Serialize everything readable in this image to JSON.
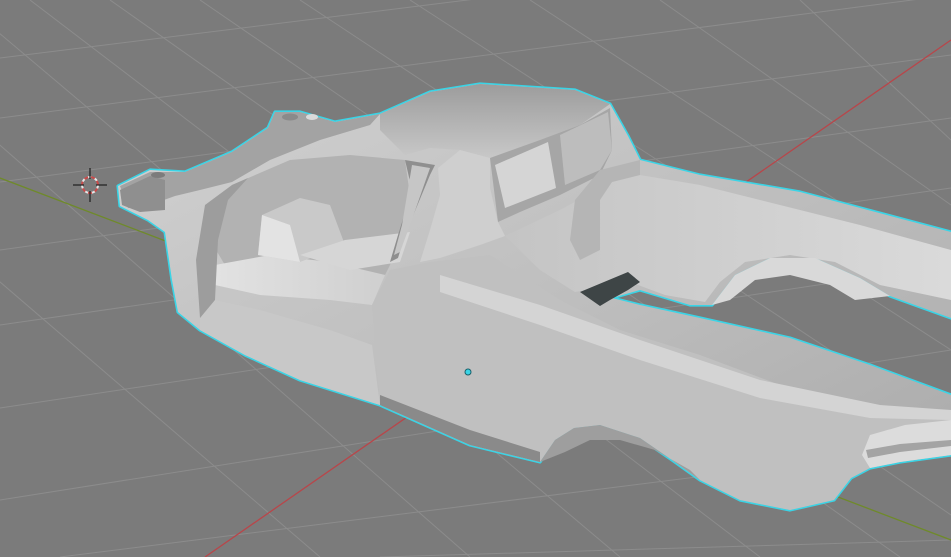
{
  "viewport": {
    "mode": "3d-viewport-solid-shading",
    "background_color": "#7b7b7b",
    "grid_color": "#8c8c8c",
    "x_axis_color": "#b8464a",
    "y_axis_color": "#6f8a2a",
    "selection_outline_color": "#3ad4e6"
  },
  "scene": {
    "objects": [
      {
        "name": "car-body-shell",
        "selected": true,
        "active": true
      }
    ],
    "cursor": {
      "visible": true,
      "icon": "3d-cursor-icon"
    },
    "origin": {
      "visible": true,
      "icon": "object-origin-icon"
    }
  }
}
